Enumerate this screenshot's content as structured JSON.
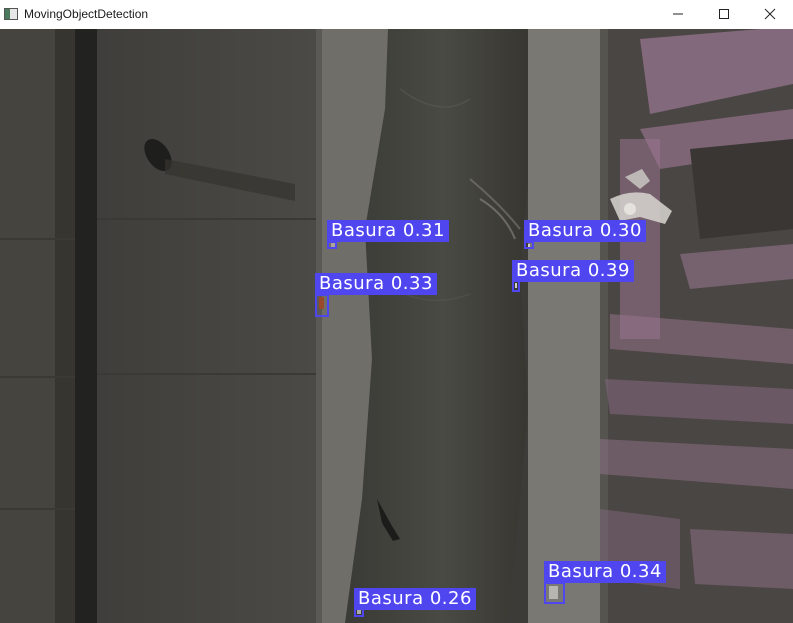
{
  "window": {
    "title": "MovingObjectDetection",
    "controls": {
      "minimize": "minimize-icon",
      "maximize": "maximize-icon",
      "close": "close-icon"
    }
  },
  "detections": [
    {
      "text": "Basura 0.31"
    },
    {
      "text": "Basura 0.30"
    },
    {
      "text": "Basura 0.33"
    },
    {
      "text": "Basura 0.39"
    },
    {
      "text": "Basura 0.34"
    },
    {
      "text": "Basura 0.26"
    }
  ],
  "colors": {
    "detection_box": "#5046f0",
    "detection_text": "#ffffff"
  }
}
